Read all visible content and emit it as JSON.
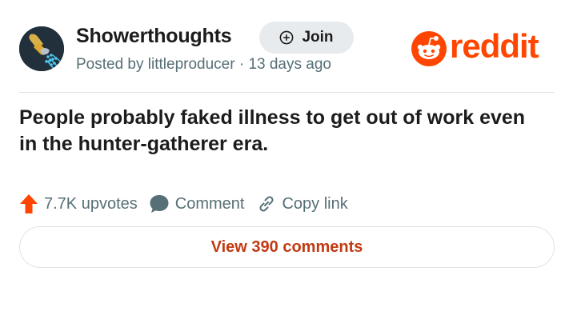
{
  "post": {
    "subreddit": "Showerthoughts",
    "join_label": "Join",
    "posted_by": "Posted by littleproducer · 13 days ago",
    "title": "People probably faked illness to get out of work even in the hunter-gatherer era.",
    "upvotes": "7.7K upvotes",
    "comment_label": "Comment",
    "copy_link_label": "Copy link",
    "view_comments_label": "View 390 comments"
  },
  "brand": {
    "logo_text": "reddit",
    "accent_color": "#ff4500",
    "link_color": "#c23a12",
    "meta_color": "#576f76"
  },
  "icons": {
    "avatar": "showerhead-icon",
    "join": "plus-circle-icon",
    "logo": "snoo-icon",
    "upvote": "upvote-arrow-icon",
    "comment": "comment-bubble-icon",
    "copy_link": "link-icon"
  }
}
